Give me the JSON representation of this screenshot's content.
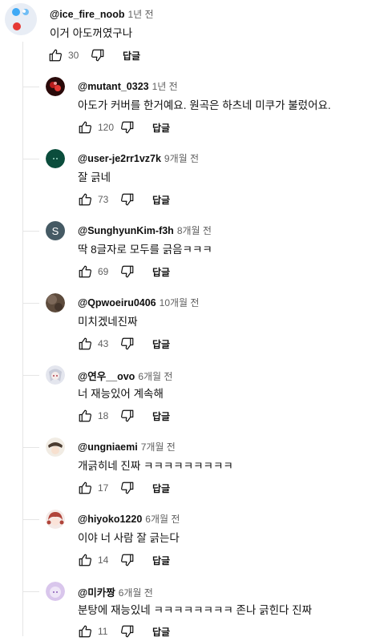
{
  "top_comment": {
    "handle": "@ice_fire_noob",
    "time": "1년 전",
    "text": "이거 아도꺼였구나",
    "likes": "30",
    "reply_label": "답글"
  },
  "replies": [
    {
      "handle": "@mutant_0323",
      "time": "1년 전",
      "text": "아도가 커버를 한거예요. 원곡은 하츠네 미쿠가 불렀어요.",
      "likes": "120",
      "reply_label": "답글"
    },
    {
      "handle": "@user-je2rr1vz7k",
      "time": "9개월 전",
      "text": "잘 긁네",
      "likes": "73",
      "reply_label": "답글"
    },
    {
      "handle": "@SunghyunKim-f3h",
      "time": "8개월 전",
      "text": "딱 8글자로 모두를 긁음ㅋㅋㅋ",
      "likes": "69",
      "reply_label": "답글",
      "avatar_letter": "S"
    },
    {
      "handle": "@Qpwoeiru0406",
      "time": "10개월 전",
      "text": "미치겠네진짜",
      "likes": "43",
      "reply_label": "답글"
    },
    {
      "handle": "@연우__ovo",
      "time": "6개월 전",
      "text": "너 재능있어 계속해",
      "likes": "18",
      "reply_label": "답글"
    },
    {
      "handle": "@ungniaemi",
      "time": "7개월 전",
      "text": "개긁히네 진짜 ㅋㅋㅋㅋㅋㅋㅋㅋㅋ",
      "likes": "17",
      "reply_label": "답글"
    },
    {
      "handle": "@hiyoko1220",
      "time": "6개월 전",
      "text": "이야 너 사람 잘 긁는다",
      "likes": "14",
      "reply_label": "답글"
    },
    {
      "handle": "@미카짱",
      "time": "6개월 전",
      "text": "분탕에 재능있네 ㅋㅋㅋㅋㅋㅋㅋㅋ 존나 긁힌다 진짜",
      "likes": "11",
      "reply_label": "답글"
    }
  ],
  "colors": {
    "text_primary": "#0f0f0f",
    "text_secondary": "#606060",
    "thread_line": "#e5e5e5"
  }
}
